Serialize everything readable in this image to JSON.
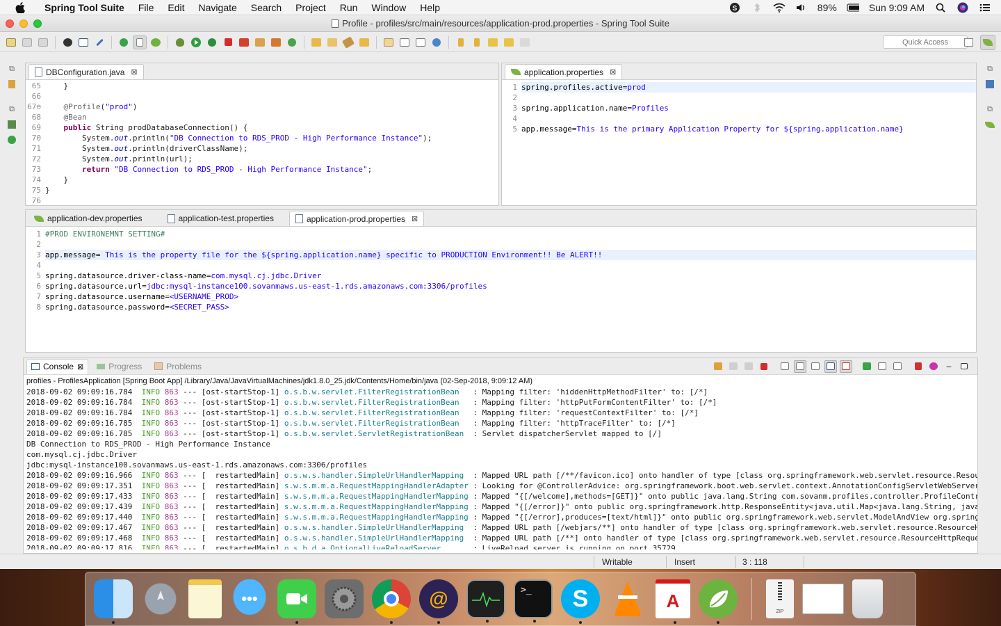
{
  "menubar": {
    "app_name": "Spring Tool Suite",
    "items": [
      "File",
      "Edit",
      "Navigate",
      "Search",
      "Project",
      "Run",
      "Window",
      "Help"
    ],
    "battery": "89%",
    "clock": "Sun 9:09 AM"
  },
  "window": {
    "title": "Profile - profiles/src/main/resources/application-prod.properties - Spring Tool Suite"
  },
  "toolbar": {
    "quick_access_placeholder": "Quick Access"
  },
  "java_editor": {
    "tab_label": "DBConfiguration.java",
    "lines": [
      {
        "n": "65",
        "code": "    }"
      },
      {
        "n": "66",
        "code": ""
      },
      {
        "n": "67⊖",
        "code": "    @Profile(\"prod\")"
      },
      {
        "n": "68",
        "code": "    @Bean"
      },
      {
        "n": "69",
        "code": "    public String prodDatabaseConnection() {"
      },
      {
        "n": "70",
        "code": "        System.out.println(\"DB Connection to RDS_PROD - High Performance Instance\");"
      },
      {
        "n": "71",
        "code": "        System.out.println(driverClassName);"
      },
      {
        "n": "72",
        "code": "        System.out.println(url);"
      },
      {
        "n": "73",
        "code": "        return \"DB Connection to RDS_PROD - High Performance Instance\";"
      },
      {
        "n": "74",
        "code": "    }"
      },
      {
        "n": "75",
        "code": "}"
      },
      {
        "n": "76",
        "code": ""
      }
    ]
  },
  "app_props_editor": {
    "tab_label": "application.properties",
    "lines": [
      {
        "n": "1",
        "key": "spring.profiles.active",
        "value": "prod"
      },
      {
        "n": "2",
        "key": "",
        "value": ""
      },
      {
        "n": "3",
        "key": "spring.application.name",
        "value": "Profiles"
      },
      {
        "n": "4",
        "key": "",
        "value": ""
      },
      {
        "n": "5",
        "key": "app.message",
        "value": "This is the primary Application Property for ${spring.application.name}"
      }
    ]
  },
  "props_editor": {
    "tabs": [
      "application-dev.properties",
      "application-test.properties",
      "application-prod.properties"
    ],
    "lines": [
      {
        "n": "1",
        "key": "#PROD ENVIRONEMNT SETTING#",
        "value": ""
      },
      {
        "n": "2",
        "key": "",
        "value": ""
      },
      {
        "n": "3",
        "key": "app.message",
        "value": " This is the property file for the ${spring.application.name} specific to PRODUCTION Environment!! Be ALERT!!"
      },
      {
        "n": "4",
        "key": "",
        "value": ""
      },
      {
        "n": "5",
        "key": "spring.datasource.driver-class-name",
        "value": "com.mysql.cj.jdbc.Driver"
      },
      {
        "n": "6",
        "key": "spring.datasource.url",
        "value": "jdbc:mysql-instance100.sovanmaws.us-east-1.rds.amazonaws.com:3306/profiles"
      },
      {
        "n": "7",
        "key": "spring.datasource.username",
        "value": "<USERNAME_PROD>"
      },
      {
        "n": "8",
        "key": "spring.datasource.password",
        "value": "<SECRET_PASS>"
      }
    ]
  },
  "console": {
    "tabs": [
      "Console",
      "Progress",
      "Problems"
    ],
    "description": "profiles - ProfilesApplication [Spring Boot App] /Library/Java/JavaVirtualMachines/jdk1.8.0_25.jdk/Contents/Home/bin/java (02-Sep-2018, 9:09:12 AM)",
    "rows": [
      {
        "ts": "2018-09-02 09:09:16.784",
        "lvl": "INFO",
        "pid": "863",
        "thread": "--- [ost-startStop-1]",
        "cls": "o.s.b.w.servlet.FilterRegistrationBean   ",
        "msg": ": Mapping filter: 'hiddenHttpMethodFilter' to: [/*]"
      },
      {
        "ts": "2018-09-02 09:09:16.784",
        "lvl": "INFO",
        "pid": "863",
        "thread": "--- [ost-startStop-1]",
        "cls": "o.s.b.w.servlet.FilterRegistrationBean   ",
        "msg": ": Mapping filter: 'httpPutFormContentFilter' to: [/*]"
      },
      {
        "ts": "2018-09-02 09:09:16.784",
        "lvl": "INFO",
        "pid": "863",
        "thread": "--- [ost-startStop-1]",
        "cls": "o.s.b.w.servlet.FilterRegistrationBean   ",
        "msg": ": Mapping filter: 'requestContextFilter' to: [/*]"
      },
      {
        "ts": "2018-09-02 09:09:16.785",
        "lvl": "INFO",
        "pid": "863",
        "thread": "--- [ost-startStop-1]",
        "cls": "o.s.b.w.servlet.FilterRegistrationBean   ",
        "msg": ": Mapping filter: 'httpTraceFilter' to: [/*]"
      },
      {
        "ts": "2018-09-02 09:09:16.785",
        "lvl": "INFO",
        "pid": "863",
        "thread": "--- [ost-startStop-1]",
        "cls": "o.s.b.w.servlet.ServletRegistrationBean  ",
        "msg": ": Servlet dispatcherServlet mapped to [/]"
      },
      {
        "plain": "DB Connection to RDS_PROD - High Performance Instance"
      },
      {
        "plain": "com.mysql.cj.jdbc.Driver"
      },
      {
        "plain": "jdbc:mysql-instance100.sovanmaws.us-east-1.rds.amazonaws.com:3306/profiles"
      },
      {
        "ts": "2018-09-02 09:09:16.966",
        "lvl": "INFO",
        "pid": "863",
        "thread": "--- [  restartedMain]",
        "cls": "o.s.w.s.handler.SimpleUrlHandlerMapping  ",
        "msg": ": Mapped URL path [/**/favicon.ico] onto handler of type [class org.springframework.web.servlet.resource.Resou"
      },
      {
        "ts": "2018-09-02 09:09:17.351",
        "lvl": "INFO",
        "pid": "863",
        "thread": "--- [  restartedMain]",
        "cls": "s.w.s.m.m.a.RequestMappingHandlerAdapter ",
        "msg": ": Looking for @ControllerAdvice: org.springframework.boot.web.servlet.context.AnnotationConfigServletWebServer"
      },
      {
        "ts": "2018-09-02 09:09:17.433",
        "lvl": "INFO",
        "pid": "863",
        "thread": "--- [  restartedMain]",
        "cls": "s.w.s.m.m.a.RequestMappingHandlerMapping ",
        "msg": ": Mapped \"{[/welcome],methods=[GET]}\" onto public java.lang.String com.sovanm.profiles.controller.ProfileContr"
      },
      {
        "ts": "2018-09-02 09:09:17.439",
        "lvl": "INFO",
        "pid": "863",
        "thread": "--- [  restartedMain]",
        "cls": "s.w.s.m.m.a.RequestMappingHandlerMapping ",
        "msg": ": Mapped \"{[/error]}\" onto public org.springframework.http.ResponseEntity<java.util.Map<java.lang.String, java"
      },
      {
        "ts": "2018-09-02 09:09:17.440",
        "lvl": "INFO",
        "pid": "863",
        "thread": "--- [  restartedMain]",
        "cls": "s.w.s.m.m.a.RequestMappingHandlerMapping ",
        "msg": ": Mapped \"{[/error],produces=[text/html]}\" onto public org.springframework.web.servlet.ModelAndView org.spring"
      },
      {
        "ts": "2018-09-02 09:09:17.467",
        "lvl": "INFO",
        "pid": "863",
        "thread": "--- [  restartedMain]",
        "cls": "o.s.w.s.handler.SimpleUrlHandlerMapping  ",
        "msg": ": Mapped URL path [/webjars/**] onto handler of type [class org.springframework.web.servlet.resource.ResourceH"
      },
      {
        "ts": "2018-09-02 09:09:17.468",
        "lvl": "INFO",
        "pid": "863",
        "thread": "--- [  restartedMain]",
        "cls": "o.s.w.s.handler.SimpleUrlHandlerMapping  ",
        "msg": ": Mapped URL path [/**] onto handler of type [class org.springframework.web.servlet.resource.ResourceHttpReque"
      },
      {
        "ts": "2018-09-02 09:09:17.816",
        "lvl": "INFO",
        "pid": "863",
        "thread": "--- [  restartedMain]",
        "cls": "o.s.b.d.a.OptionalLiveReloadServer       ",
        "msg": ": LiveReload server is running on port 35729"
      }
    ]
  },
  "statusbar": {
    "writable": "Writable",
    "insert": "Insert",
    "position": "3 : 118"
  },
  "colors": {
    "spring_green": "#6db33f",
    "keyword": "#7f0055",
    "string": "#2a00ff",
    "log_info": "#4d9a2a",
    "log_class": "#1c7f8f"
  },
  "dock": {
    "apps": [
      "finder-icon",
      "launchpad-icon",
      "notes-icon",
      "messages-icon",
      "facetime-icon",
      "system-preferences-icon",
      "chrome-icon",
      "eclipse-icon",
      "activity-monitor-icon",
      "terminal-icon",
      "skype-icon",
      "vlc-icon",
      "acrobat-icon",
      "spring-tool-suite-icon",
      "zip-archive-icon",
      "screenshot-icon",
      "trash-icon"
    ]
  }
}
